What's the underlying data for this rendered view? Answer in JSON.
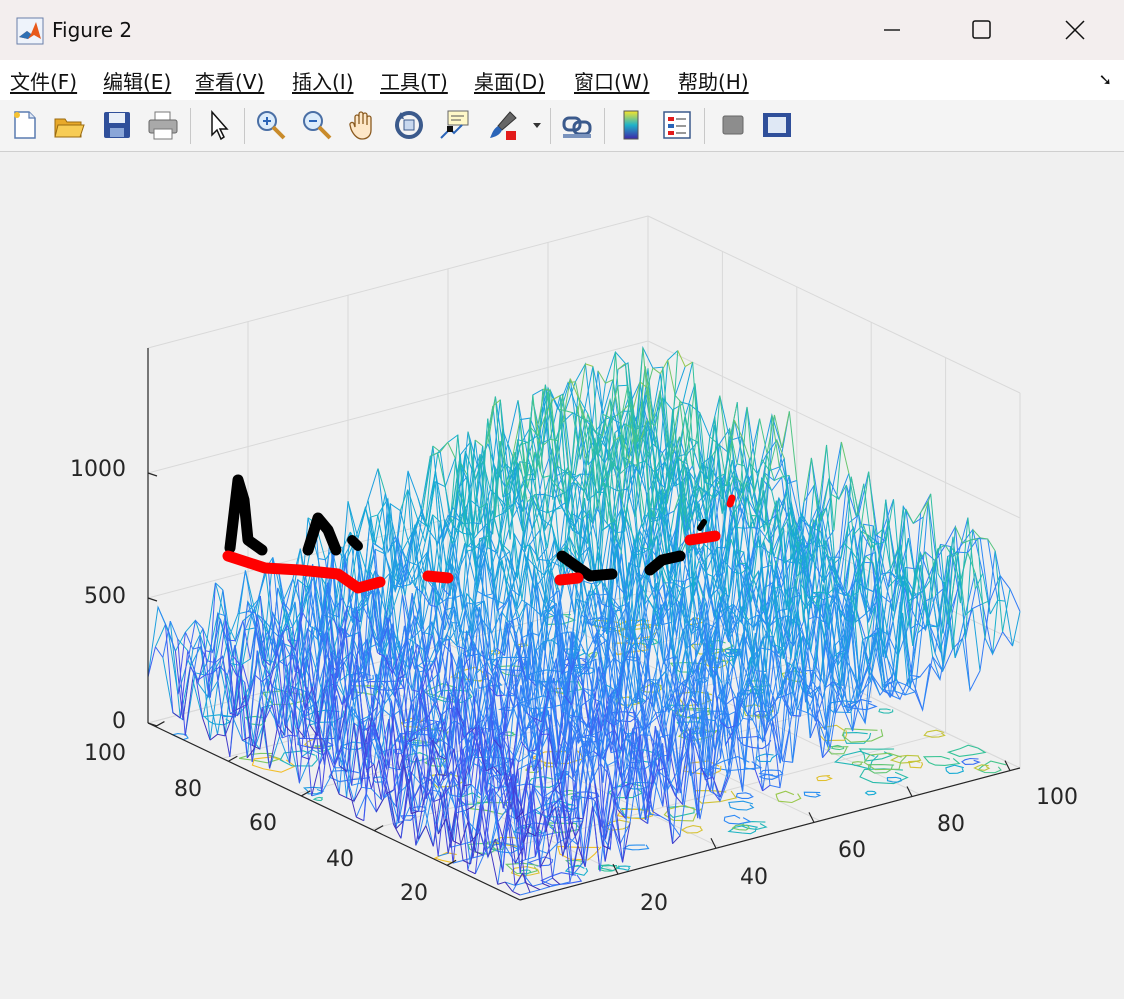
{
  "window": {
    "title": "Figure 2"
  },
  "menu": {
    "items": [
      "文件(F)",
      "编辑(E)",
      "查看(V)",
      "插入(I)",
      "工具(T)",
      "桌面(D)",
      "窗口(W)",
      "帮助(H)"
    ],
    "more_icon": "dock-arrow-icon"
  },
  "toolbar": {
    "buttons": [
      "new-figure-icon",
      "open-file-icon",
      "save-icon",
      "print-icon",
      "select-arrow-icon",
      "zoom-in-icon",
      "zoom-out-icon",
      "pan-hand-icon",
      "rotate-3d-icon",
      "data-cursor-icon",
      "brush-icon",
      "link-plot-icon",
      "colorbar-icon",
      "legend-icon",
      "hide-plot-tools-icon",
      "show-plot-tools-icon"
    ]
  },
  "axes": {
    "z_ticks": [
      "0",
      "500",
      "1000"
    ],
    "x_ticks": [
      "20",
      "40",
      "60",
      "80",
      "100"
    ],
    "y_ticks": [
      "20",
      "40",
      "60",
      "80",
      "100"
    ]
  },
  "chart_data": {
    "type": "mesh3d",
    "title": "",
    "xlabel": "",
    "ylabel": "",
    "zlabel": "",
    "xlim": [
      1,
      100
    ],
    "ylim": [
      1,
      100
    ],
    "zlim": [
      0,
      1500
    ],
    "colormap": "parula",
    "has_contour_base": true,
    "overlay_lines": [
      {
        "color": "#ff0000",
        "description_values": [
          650,
          620,
          610,
          560,
          600
        ]
      },
      {
        "color": "#000000",
        "description_values": [
          950,
          800,
          750,
          700,
          650
        ]
      }
    ]
  }
}
